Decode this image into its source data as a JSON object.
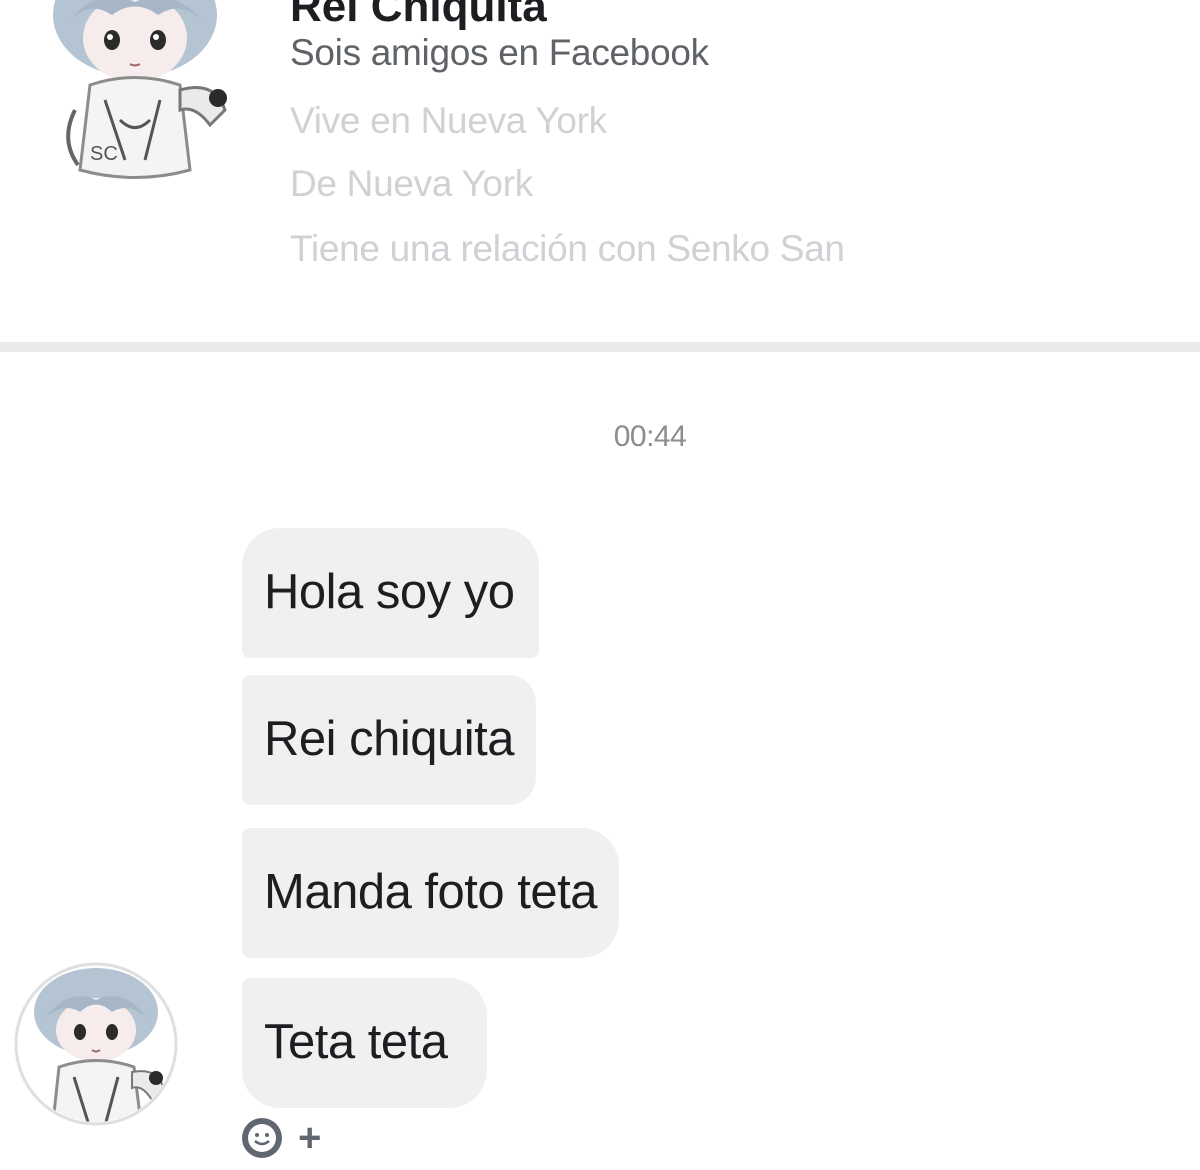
{
  "profile": {
    "name": "Rei Chiquita",
    "friends_text": "Sois amigos en Facebook",
    "lives_in": "Vive en Nueva York",
    "from": "De Nueva York",
    "relationship": "Tiene una relación con Senko San"
  },
  "conversation": {
    "timestamp": "00:44",
    "messages": [
      "Hola soy yo",
      "Rei chiquita",
      "Manda foto teta",
      "Teta teta"
    ],
    "actions": {
      "emoji_icon": "smiley-face-icon",
      "plus_label": "+"
    }
  }
}
